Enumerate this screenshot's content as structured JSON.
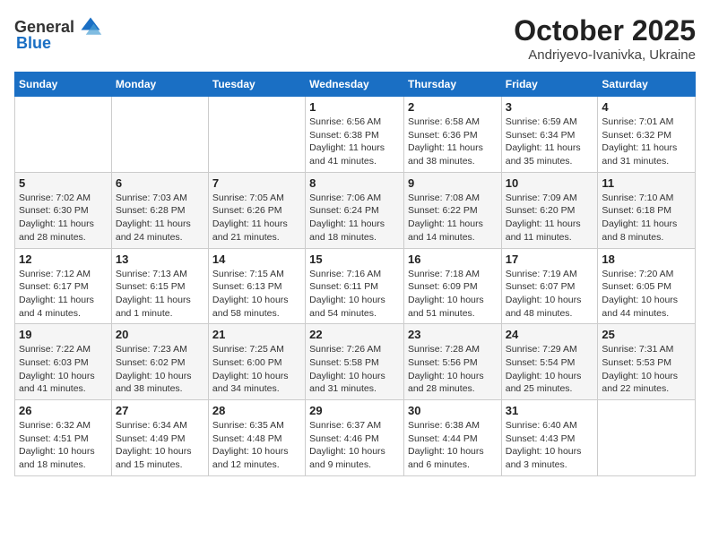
{
  "logo": {
    "general": "General",
    "blue": "Blue"
  },
  "title": "October 2025",
  "location": "Andriyevo-Ivanivka, Ukraine",
  "weekdays": [
    "Sunday",
    "Monday",
    "Tuesday",
    "Wednesday",
    "Thursday",
    "Friday",
    "Saturday"
  ],
  "weeks": [
    [
      {
        "day": "",
        "info": ""
      },
      {
        "day": "",
        "info": ""
      },
      {
        "day": "",
        "info": ""
      },
      {
        "day": "1",
        "info": "Sunrise: 6:56 AM\nSunset: 6:38 PM\nDaylight: 11 hours and 41 minutes."
      },
      {
        "day": "2",
        "info": "Sunrise: 6:58 AM\nSunset: 6:36 PM\nDaylight: 11 hours and 38 minutes."
      },
      {
        "day": "3",
        "info": "Sunrise: 6:59 AM\nSunset: 6:34 PM\nDaylight: 11 hours and 35 minutes."
      },
      {
        "day": "4",
        "info": "Sunrise: 7:01 AM\nSunset: 6:32 PM\nDaylight: 11 hours and 31 minutes."
      }
    ],
    [
      {
        "day": "5",
        "info": "Sunrise: 7:02 AM\nSunset: 6:30 PM\nDaylight: 11 hours and 28 minutes."
      },
      {
        "day": "6",
        "info": "Sunrise: 7:03 AM\nSunset: 6:28 PM\nDaylight: 11 hours and 24 minutes."
      },
      {
        "day": "7",
        "info": "Sunrise: 7:05 AM\nSunset: 6:26 PM\nDaylight: 11 hours and 21 minutes."
      },
      {
        "day": "8",
        "info": "Sunrise: 7:06 AM\nSunset: 6:24 PM\nDaylight: 11 hours and 18 minutes."
      },
      {
        "day": "9",
        "info": "Sunrise: 7:08 AM\nSunset: 6:22 PM\nDaylight: 11 hours and 14 minutes."
      },
      {
        "day": "10",
        "info": "Sunrise: 7:09 AM\nSunset: 6:20 PM\nDaylight: 11 hours and 11 minutes."
      },
      {
        "day": "11",
        "info": "Sunrise: 7:10 AM\nSunset: 6:18 PM\nDaylight: 11 hours and 8 minutes."
      }
    ],
    [
      {
        "day": "12",
        "info": "Sunrise: 7:12 AM\nSunset: 6:17 PM\nDaylight: 11 hours and 4 minutes."
      },
      {
        "day": "13",
        "info": "Sunrise: 7:13 AM\nSunset: 6:15 PM\nDaylight: 11 hours and 1 minute."
      },
      {
        "day": "14",
        "info": "Sunrise: 7:15 AM\nSunset: 6:13 PM\nDaylight: 10 hours and 58 minutes."
      },
      {
        "day": "15",
        "info": "Sunrise: 7:16 AM\nSunset: 6:11 PM\nDaylight: 10 hours and 54 minutes."
      },
      {
        "day": "16",
        "info": "Sunrise: 7:18 AM\nSunset: 6:09 PM\nDaylight: 10 hours and 51 minutes."
      },
      {
        "day": "17",
        "info": "Sunrise: 7:19 AM\nSunset: 6:07 PM\nDaylight: 10 hours and 48 minutes."
      },
      {
        "day": "18",
        "info": "Sunrise: 7:20 AM\nSunset: 6:05 PM\nDaylight: 10 hours and 44 minutes."
      }
    ],
    [
      {
        "day": "19",
        "info": "Sunrise: 7:22 AM\nSunset: 6:03 PM\nDaylight: 10 hours and 41 minutes."
      },
      {
        "day": "20",
        "info": "Sunrise: 7:23 AM\nSunset: 6:02 PM\nDaylight: 10 hours and 38 minutes."
      },
      {
        "day": "21",
        "info": "Sunrise: 7:25 AM\nSunset: 6:00 PM\nDaylight: 10 hours and 34 minutes."
      },
      {
        "day": "22",
        "info": "Sunrise: 7:26 AM\nSunset: 5:58 PM\nDaylight: 10 hours and 31 minutes."
      },
      {
        "day": "23",
        "info": "Sunrise: 7:28 AM\nSunset: 5:56 PM\nDaylight: 10 hours and 28 minutes."
      },
      {
        "day": "24",
        "info": "Sunrise: 7:29 AM\nSunset: 5:54 PM\nDaylight: 10 hours and 25 minutes."
      },
      {
        "day": "25",
        "info": "Sunrise: 7:31 AM\nSunset: 5:53 PM\nDaylight: 10 hours and 22 minutes."
      }
    ],
    [
      {
        "day": "26",
        "info": "Sunrise: 6:32 AM\nSunset: 4:51 PM\nDaylight: 10 hours and 18 minutes."
      },
      {
        "day": "27",
        "info": "Sunrise: 6:34 AM\nSunset: 4:49 PM\nDaylight: 10 hours and 15 minutes."
      },
      {
        "day": "28",
        "info": "Sunrise: 6:35 AM\nSunset: 4:48 PM\nDaylight: 10 hours and 12 minutes."
      },
      {
        "day": "29",
        "info": "Sunrise: 6:37 AM\nSunset: 4:46 PM\nDaylight: 10 hours and 9 minutes."
      },
      {
        "day": "30",
        "info": "Sunrise: 6:38 AM\nSunset: 4:44 PM\nDaylight: 10 hours and 6 minutes."
      },
      {
        "day": "31",
        "info": "Sunrise: 6:40 AM\nSunset: 4:43 PM\nDaylight: 10 hours and 3 minutes."
      },
      {
        "day": "",
        "info": ""
      }
    ]
  ]
}
